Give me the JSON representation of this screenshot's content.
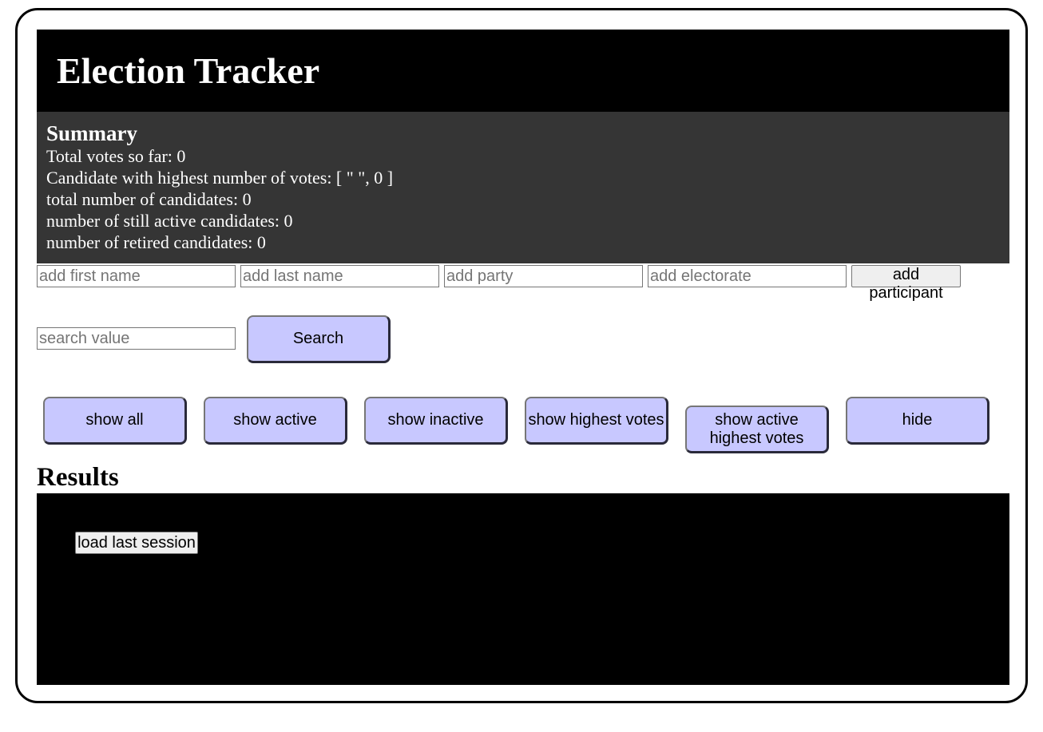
{
  "header": {
    "title": "Election Tracker"
  },
  "summary": {
    "heading": "Summary",
    "total_votes": "Total votes so far: 0",
    "highest_candidate": "Candidate with highest number of votes: [ \" \", 0 ]",
    "total_candidates": "total number of candidates: 0",
    "active_candidates": "number of still active candidates: 0",
    "retired_candidates": "number of retired candidates: 0"
  },
  "add_form": {
    "first_name_placeholder": "add first name",
    "last_name_placeholder": "add last name",
    "party_placeholder": "add party",
    "electorate_placeholder": "add electorate",
    "add_label": "add participant"
  },
  "search": {
    "placeholder": "search value",
    "button_label": "Search"
  },
  "filters": {
    "show_all": "show all",
    "show_active": "show active",
    "show_inactive": "show inactive",
    "show_highest": "show highest votes",
    "show_active_highest": "show active highest votes",
    "hide": "hide"
  },
  "results": {
    "title": "Results",
    "load_label": "load last session"
  },
  "colors": {
    "header_bg": "#000000",
    "summary_bg": "#353535",
    "button_bg": "#c8c8ff",
    "results_bg": "#000000"
  }
}
